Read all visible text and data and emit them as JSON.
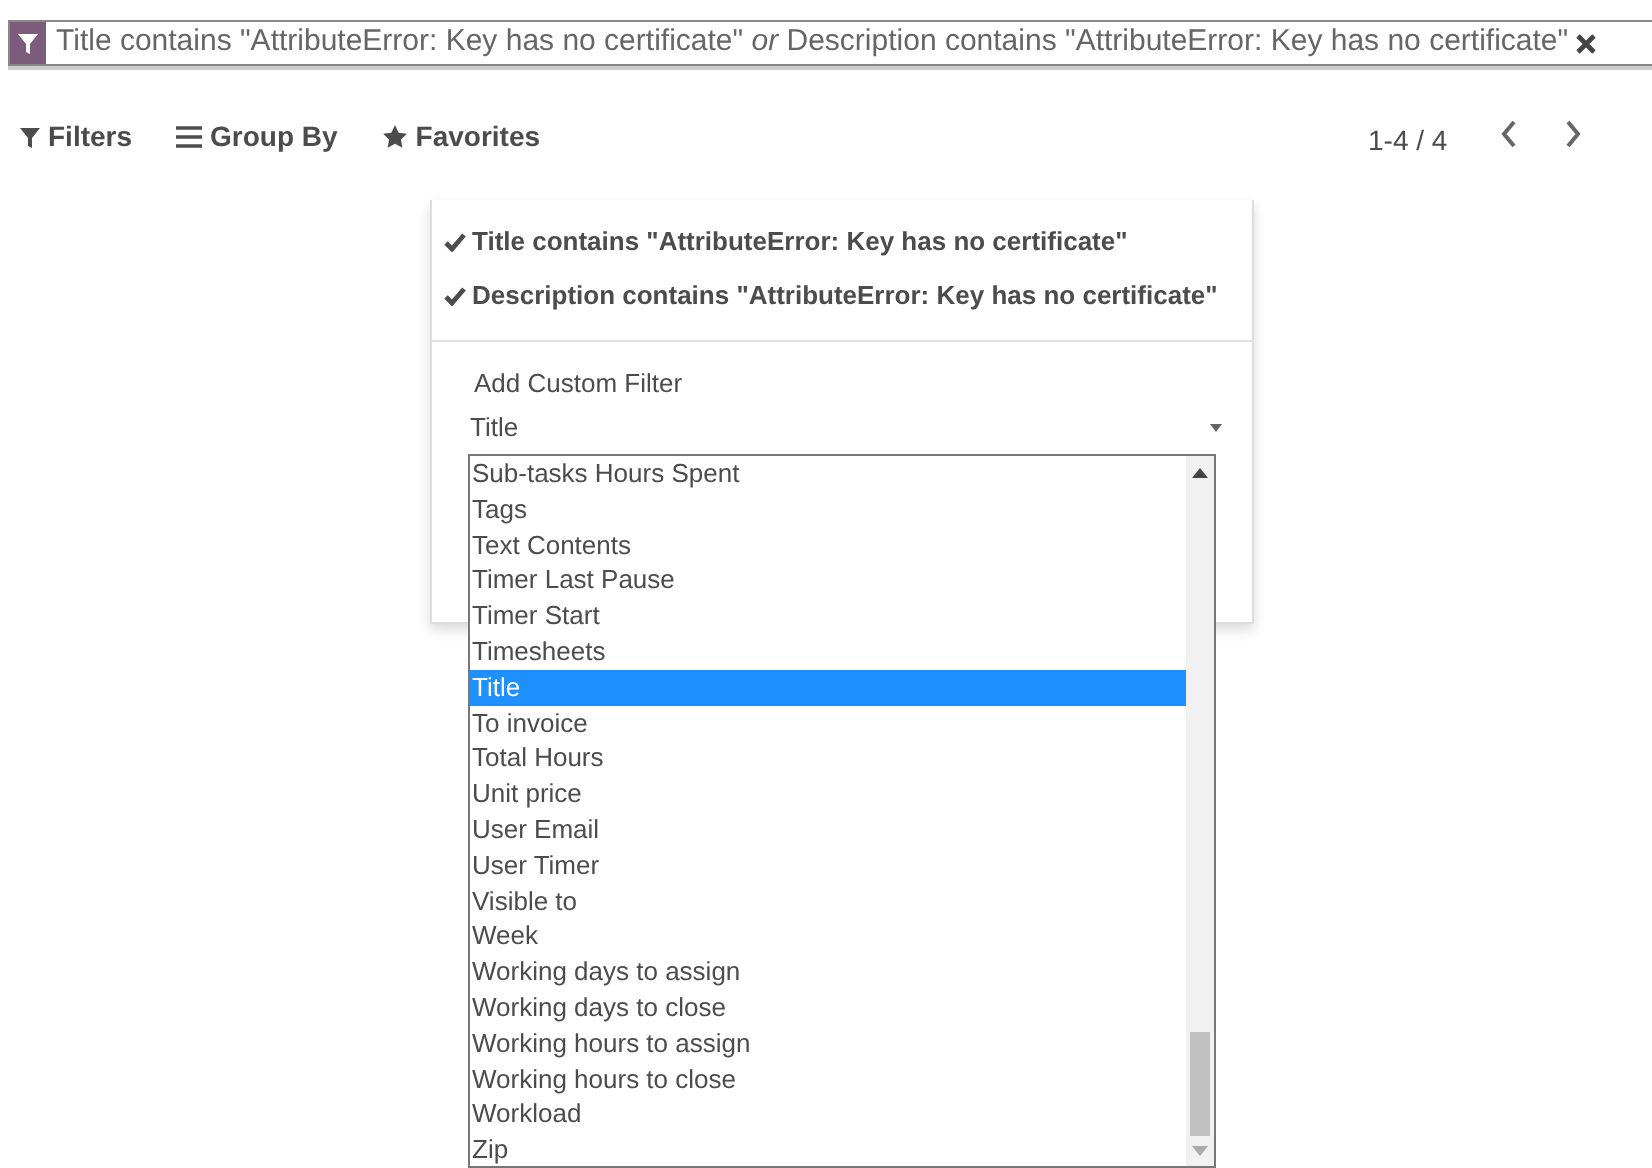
{
  "search": {
    "facet_text": "Title contains \"AttributeError: Key has no certificate\" *or* Description contains \"AttributeError: Key has no certificate\""
  },
  "toolbar": {
    "buttons": [
      {
        "label": "Filters",
        "kind": "filter"
      },
      {
        "label": "Group By",
        "kind": "bars"
      },
      {
        "label": "Favorites",
        "kind": "star"
      }
    ],
    "pager": "1-4 / 4"
  },
  "filters_menu": {
    "items": [
      {
        "label": "Title contains \"AttributeError: Key has no certificate\"",
        "checked": true
      },
      {
        "label": "Description contains \"AttributeError: Key has no certificate\"",
        "checked": true
      }
    ],
    "custom_filter": {
      "label": "Add Custom Filter",
      "field_value": "Title",
      "options": [
        {
          "label": "Sub-tasks Hours Spent",
          "selected": false
        },
        {
          "label": "Tags",
          "selected": false
        },
        {
          "label": "Text Contents",
          "selected": false
        },
        {
          "label": "Timer Last Pause",
          "selected": false
        },
        {
          "label": "Timer Start",
          "selected": false
        },
        {
          "label": "Timesheets",
          "selected": false
        },
        {
          "label": "Title",
          "selected": true
        },
        {
          "label": "To invoice",
          "selected": false
        },
        {
          "label": "Total Hours",
          "selected": false
        },
        {
          "label": "Unit price",
          "selected": false
        },
        {
          "label": "User Email",
          "selected": false
        },
        {
          "label": "User Timer",
          "selected": false
        },
        {
          "label": "Visible to",
          "selected": false
        },
        {
          "label": "Week",
          "selected": false
        },
        {
          "label": "Working days to assign",
          "selected": false
        },
        {
          "label": "Working days to close",
          "selected": false
        },
        {
          "label": "Working hours to assign",
          "selected": false
        },
        {
          "label": "Working hours to close",
          "selected": false
        },
        {
          "label": "Workload",
          "selected": false
        },
        {
          "label": "Zip",
          "selected": false
        }
      ]
    }
  }
}
